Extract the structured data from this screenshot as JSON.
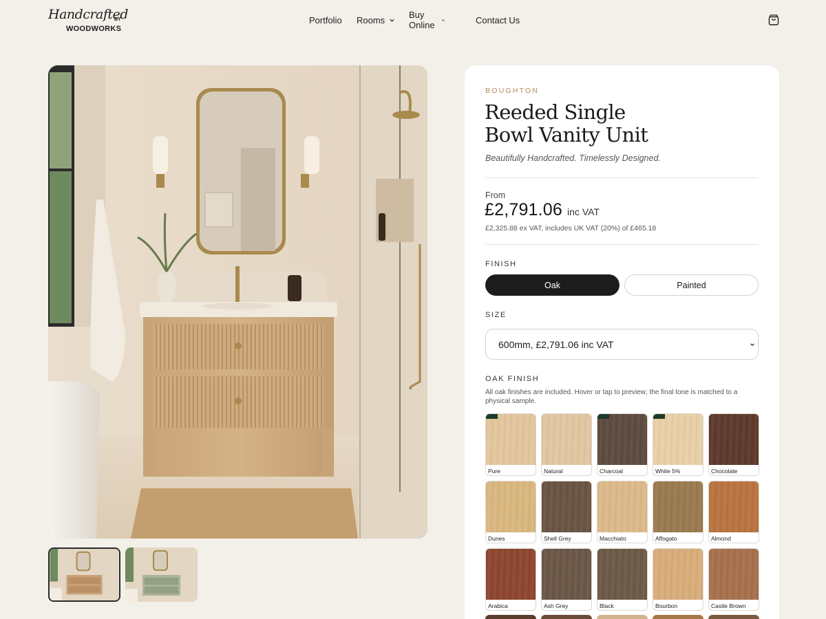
{
  "logo": {
    "script": "Handcrafted",
    "by": "BY",
    "sub": "WOODWORKS"
  },
  "nav": {
    "items": [
      {
        "label": "Portfolio",
        "dropdown": false
      },
      {
        "label": "Rooms",
        "dropdown": true
      },
      {
        "label": "Buy Online",
        "dropdown": true
      },
      {
        "label": "Contact Us",
        "dropdown": false
      }
    ],
    "cart_icon": "shopping-bag-icon"
  },
  "gallery": {
    "thumbnails": [
      {
        "variant": "oak",
        "active": true
      },
      {
        "variant": "painted-sage",
        "active": false
      }
    ]
  },
  "product": {
    "brand": "BOUGHTON",
    "title_line1": "Reeded Single",
    "title_line2": "Bowl Vanity Unit",
    "tagline": "Beautifully Handcrafted. Timelessly Designed.",
    "from_label": "From",
    "price": "£2,791.06",
    "price_suffix": "inc VAT",
    "price_note": "£2,325.88 ex VAT, includes UK VAT (20%) of £465.18"
  },
  "finish": {
    "label": "FINISH",
    "options": [
      {
        "label": "Oak",
        "selected": true
      },
      {
        "label": "Painted",
        "selected": false
      }
    ]
  },
  "size": {
    "label": "SIZE",
    "selected": "600mm, £2,791.06 inc VAT"
  },
  "oak_finish": {
    "label": "OAK FINISH",
    "note": "All oak finishes are included. Hover or tap to preview; the final tone is matched to a physical sample.",
    "swatches": [
      {
        "name": "Pure",
        "color": "#e3c69d",
        "tag": true
      },
      {
        "name": "Natural",
        "color": "#e2c6a2",
        "tag": false
      },
      {
        "name": "Charcoal",
        "color": "#5d4b3f",
        "tag": true
      },
      {
        "name": "White 5%",
        "color": "#e8cfa8",
        "tag": true
      },
      {
        "name": "Chocolate",
        "color": "#5e3a2c",
        "tag": false
      },
      {
        "name": "Dunes",
        "color": "#d9b77f",
        "tag": false
      },
      {
        "name": "Shell Grey",
        "color": "#6a5443",
        "tag": false
      },
      {
        "name": "Macchiato",
        "color": "#dcb98a",
        "tag": false
      },
      {
        "name": "Affogato",
        "color": "#9a7a4f",
        "tag": false
      },
      {
        "name": "Almond",
        "color": "#b97440",
        "tag": false
      },
      {
        "name": "Arabica",
        "color": "#8e4630",
        "tag": false
      },
      {
        "name": "Ash Grey",
        "color": "#6b5747",
        "tag": false
      },
      {
        "name": "Black",
        "color": "#6d5a47",
        "tag": false
      },
      {
        "name": "Bourbon",
        "color": "#d9ad7b",
        "tag": false
      },
      {
        "name": "Castle Brown",
        "color": "#a7704c",
        "tag": false
      }
    ],
    "partial_row_colors": [
      "#5a3d2c",
      "#6b4c38",
      "#d1b48e",
      "#a47848",
      "#7a5a40"
    ]
  },
  "colors": {
    "page_bg": "#f3efe9",
    "accent_brand": "#b08a55",
    "selected_bg": "#1c1c1c"
  }
}
